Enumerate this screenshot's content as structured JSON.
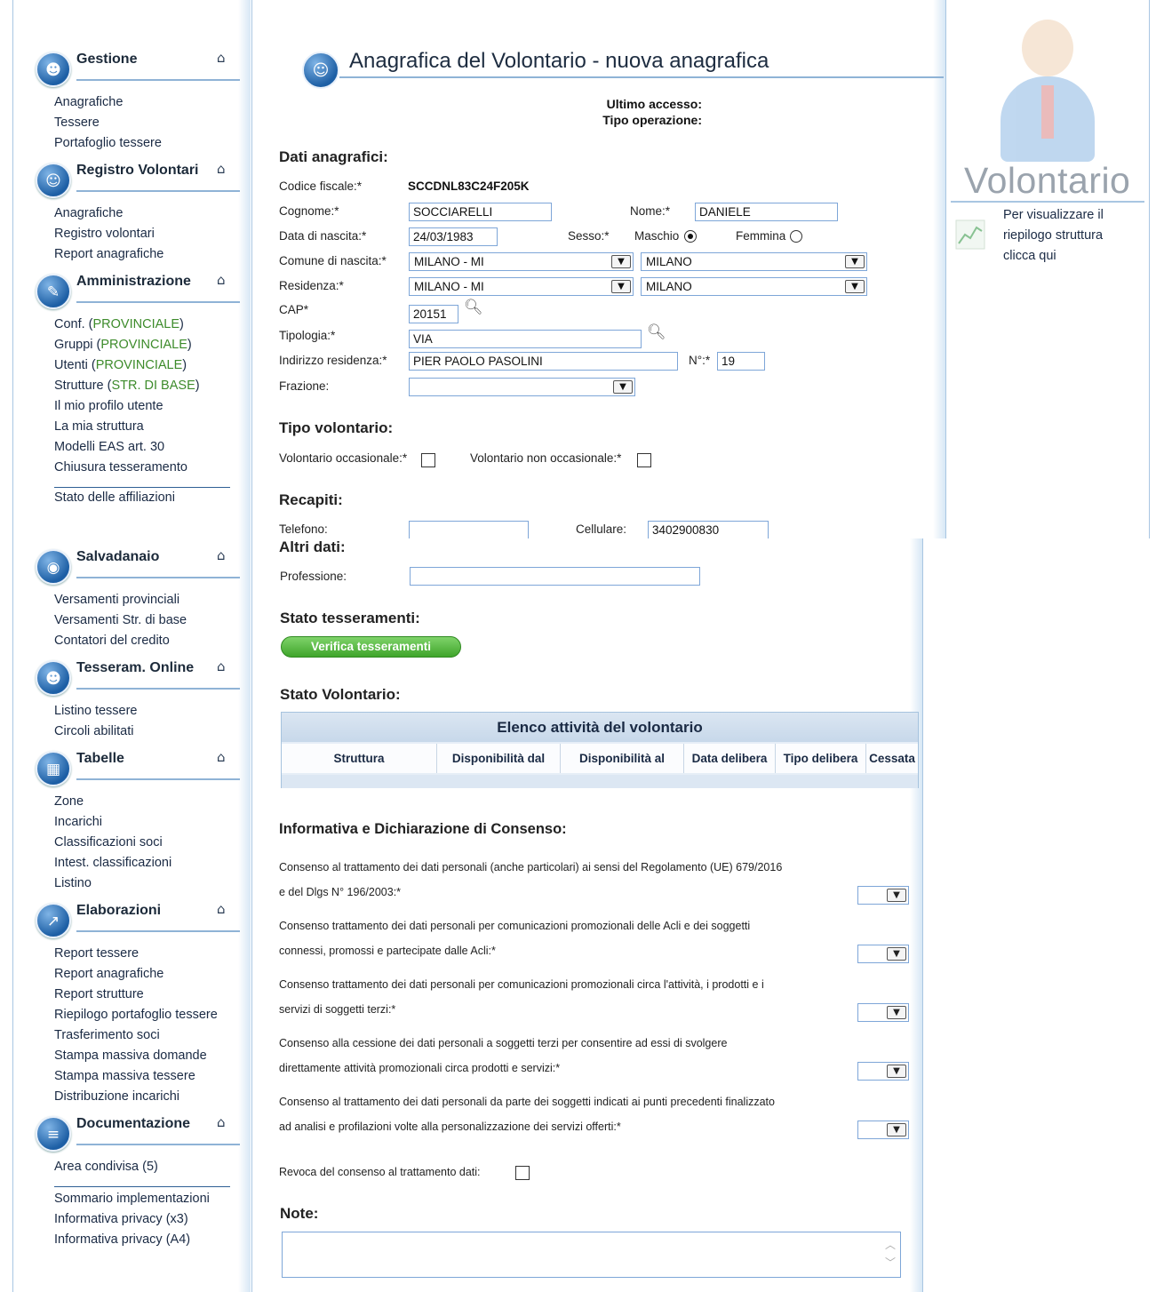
{
  "sidebar_top": [
    {
      "title": "Gestione",
      "icon": "users-icon",
      "items": [
        "Anagrafiche",
        "Tessere",
        "Portafoglio tessere"
      ]
    },
    {
      "title": "Registro Volontari",
      "icon": "volunteer-icon",
      "items": [
        "Anagrafiche",
        "Registro volontari",
        "Report anagrafiche"
      ]
    },
    {
      "title": "Amministrazione",
      "icon": "wrench-icon",
      "items_rich": [
        {
          "text": "Conf. (",
          "tag": "PROVINCIALE",
          "tail": ")"
        },
        {
          "text": "Gruppi (",
          "tag": "PROVINCIALE",
          "tail": ")"
        },
        {
          "text": "Utenti (",
          "tag": "PROVINCIALE",
          "tail": ")"
        },
        {
          "text": "Strutture (",
          "tag": "STR. DI BASE",
          "tail": ")"
        }
      ],
      "items": [
        "Il mio profilo utente",
        "La mia struttura",
        "Modelli EAS art. 30",
        "Chiusura tesseramento"
      ]
    }
  ],
  "sidebar_cut": "Stato delle affiliazioni",
  "sidebar_bottom": [
    {
      "title": "Salvadanaio",
      "icon": "piggy-bank-icon",
      "items": [
        "Versamenti provinciali",
        "Versamenti Str. di base",
        "Contatori del credito"
      ]
    },
    {
      "title": "Tesseram. Online",
      "icon": "users-icon",
      "items": [
        "Listino tessere",
        "Circoli abilitati"
      ]
    },
    {
      "title": "Tabelle",
      "icon": "grid-icon",
      "items": [
        "Zone",
        "Incarichi",
        "Classificazioni soci",
        "Intest. classificazioni",
        "Listino"
      ]
    },
    {
      "title": "Elaborazioni",
      "icon": "chart-icon",
      "items": [
        "Report tessere",
        "Report anagrafiche",
        "Report strutture",
        "Riepilogo portafoglio tessere",
        "Trasferimento soci",
        "Stampa massiva domande",
        "Stampa massiva tessere",
        "Distribuzione incarichi"
      ]
    },
    {
      "title": "Documentazione",
      "icon": "docs-icon",
      "items": [
        "Area condivisa (5)"
      ]
    }
  ],
  "sidebar_footer": [
    "Sommario implementazioni",
    "Informativa privacy (x3)",
    "Informativa privacy (A4)"
  ],
  "right_panel": {
    "word": "Volontario",
    "text": "Per visualizzare il riepilogo struttura clicca qui"
  },
  "page": {
    "title": "Anagrafica del Volontario - nuova anagrafica",
    "last_access_label": "Ultimo accesso:",
    "operation_label": "Tipo operazione:"
  },
  "dati_anagrafici": {
    "heading": "Dati anagrafici:",
    "codice_fiscale_label": "Codice fiscale:*",
    "codice_fiscale": "SCCDNL83C24F205K",
    "cognome_label": "Cognome:*",
    "cognome": "SOCCIARELLI",
    "nome_label": "Nome:*",
    "nome": "DANIELE",
    "nascita_label": "Data di nascita:*",
    "nascita": "24/03/1983",
    "sesso_label": "Sesso:*",
    "maschio": "Maschio",
    "femmina": "Femmina",
    "comune_label": "Comune di nascita:*",
    "comune_prov": "MILANO - MI",
    "comune_city": "MILANO",
    "residenza_label": "Residenza:*",
    "residenza_prov": "MILANO - MI",
    "residenza_city": "MILANO",
    "cap_label": "CAP*",
    "cap": "20151",
    "tipologia_label": "Tipologia:*",
    "tipologia": "VIA",
    "indirizzo_label": "Indirizzo residenza:*",
    "indirizzo": "PIER PAOLO PASOLINI",
    "numero_label": "N°:*",
    "numero": "19",
    "frazione_label": "Frazione:"
  },
  "tipo_volontario": {
    "heading": "Tipo volontario:",
    "occasionale": "Volontario occasionale:*",
    "non_occasionale": "Volontario non occasionale:*"
  },
  "recapiti": {
    "heading": "Recapiti:",
    "telefono_label": "Telefono:",
    "telefono": "",
    "cellulare_label": "Cellulare:",
    "cellulare": "3402900830"
  },
  "altri_dati": {
    "heading": "Altri dati:",
    "professione_label": "Professione:",
    "professione": ""
  },
  "stato_tesseramenti": {
    "heading": "Stato tesseramenti:",
    "button": "Verifica tesseramenti"
  },
  "stato_volontario": {
    "heading": "Stato Volontario:",
    "table_title": "Elenco attività del volontario",
    "columns": [
      "Struttura",
      "Disponibilità dal",
      "Disponibilità al",
      "Data delibera",
      "Tipo delibera",
      "Cessata"
    ]
  },
  "consenso": {
    "heading": "Informativa e Dichiarazione di Consenso:",
    "items": [
      [
        "Consenso al trattamento dei dati personali (anche particolari) ai sensi del Regolamento (UE) 679/2016",
        "e del Dlgs N° 196/2003:*"
      ],
      [
        "Consenso trattamento dei dati personali per comunicazioni promozionali delle Acli e dei soggetti",
        "connessi, promossi e partecipate dalle Acli:*"
      ],
      [
        "Consenso trattamento dei dati personali per comunicazioni promozionali circa l'attività, i prodotti e i",
        "servizi di soggetti terzi:*"
      ],
      [
        "Consenso alla cessione dei dati personali a soggetti terzi per consentire ad essi di svolgere",
        "direttamente attività promozionali circa prodotti e servizi:*"
      ],
      [
        "Consenso al trattamento dei dati personali da parte dei soggetti indicati ai punti precedenti finalizzato",
        "ad analisi e profilazioni volte alla personalizzazione dei servizi offerti:*"
      ]
    ],
    "revoca_label": "Revoca del consenso al trattamento dati:"
  },
  "note": {
    "heading": "Note:"
  },
  "colors": {
    "accent": "#1d5fa5",
    "green_tag": "#3d8b2b",
    "rule": "#8fb3d6"
  }
}
